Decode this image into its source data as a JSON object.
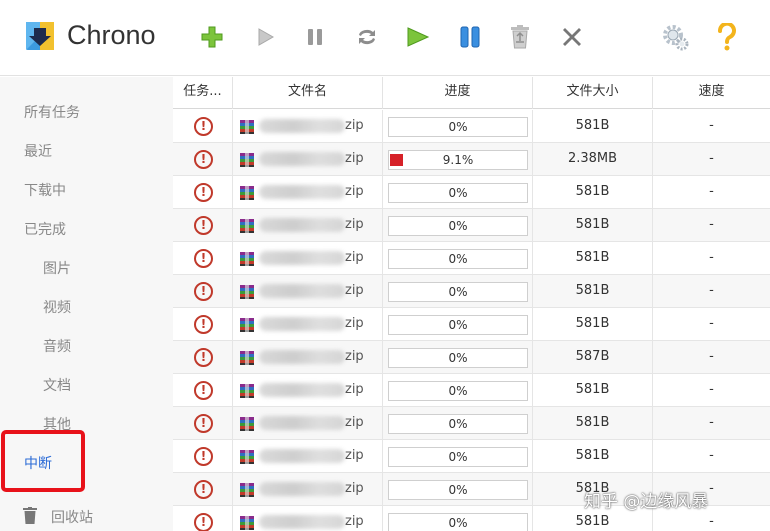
{
  "app": {
    "title": "Chrono"
  },
  "toolbar": [
    {
      "name": "add-task-button",
      "icon": "plus-icon"
    },
    {
      "name": "start-button",
      "icon": "play-icon"
    },
    {
      "name": "pause-button",
      "icon": "pause-icon"
    },
    {
      "name": "refresh-button",
      "icon": "refresh-icon"
    },
    {
      "name": "start-all-button",
      "icon": "play-all-icon"
    },
    {
      "name": "pause-all-button",
      "icon": "pause-all-icon"
    },
    {
      "name": "recycle-button",
      "icon": "recycle-bin-icon"
    },
    {
      "name": "delete-button",
      "icon": "delete-x-icon"
    },
    {
      "name": "settings-button",
      "icon": "gear-icon"
    },
    {
      "name": "help-button",
      "icon": "help-icon"
    }
  ],
  "sidebar": {
    "items": [
      {
        "label": "所有任务"
      },
      {
        "label": "最近"
      },
      {
        "label": "下载中"
      },
      {
        "label": "已完成"
      },
      {
        "label": "图片"
      },
      {
        "label": "视频"
      },
      {
        "label": "音频"
      },
      {
        "label": "文档"
      },
      {
        "label": "其他"
      },
      {
        "label": "中断"
      },
      {
        "label": "回收站"
      }
    ]
  },
  "table": {
    "columns": [
      "任务...",
      "文件名",
      "进度",
      "文件大小",
      "速度"
    ],
    "rows": [
      {
        "ext": "zip",
        "progress_text": "0%",
        "progress": 0,
        "size": "581B",
        "speed": "-"
      },
      {
        "ext": "zip",
        "progress_text": "9.1%",
        "progress": 0.091,
        "size": "2.38MB",
        "speed": "-"
      },
      {
        "ext": "zip",
        "progress_text": "0%",
        "progress": 0,
        "size": "581B",
        "speed": "-"
      },
      {
        "ext": "zip",
        "progress_text": "0%",
        "progress": 0,
        "size": "581B",
        "speed": "-"
      },
      {
        "ext": "zip",
        "progress_text": "0%",
        "progress": 0,
        "size": "581B",
        "speed": "-"
      },
      {
        "ext": "zip",
        "progress_text": "0%",
        "progress": 0,
        "size": "581B",
        "speed": "-"
      },
      {
        "ext": "zip",
        "progress_text": "0%",
        "progress": 0,
        "size": "581B",
        "speed": "-"
      },
      {
        "ext": "zip",
        "progress_text": "0%",
        "progress": 0,
        "size": "587B",
        "speed": "-"
      },
      {
        "ext": "zip",
        "progress_text": "0%",
        "progress": 0,
        "size": "581B",
        "speed": "-"
      },
      {
        "ext": "zip",
        "progress_text": "0%",
        "progress": 0,
        "size": "581B",
        "speed": "-"
      },
      {
        "ext": "zip",
        "progress_text": "0%",
        "progress": 0,
        "size": "581B",
        "speed": "-"
      },
      {
        "ext": "zip",
        "progress_text": "0%",
        "progress": 0,
        "size": "581B",
        "speed": "-"
      },
      {
        "ext": "zip",
        "progress_text": "0%",
        "progress": 0,
        "size": "581B",
        "speed": "-"
      }
    ]
  },
  "watermark": "知乎 @边缘风暴",
  "colors": {
    "accent": "#2b6bd6",
    "error": "#c0392b",
    "progress_fill": "#d62128",
    "highlight": "#e8121a"
  }
}
